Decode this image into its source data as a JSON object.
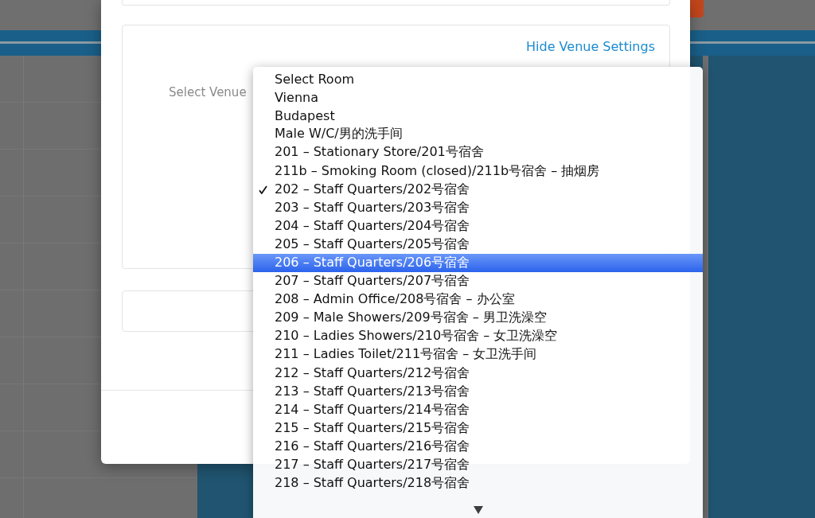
{
  "dialog": {
    "venue_settings": {
      "toggle_link": "Hide Venue Settings",
      "venue_label": "Select Venue"
    }
  },
  "room_dropdown": {
    "options": [
      {
        "label": "Select Room",
        "checked": false,
        "selected": false
      },
      {
        "label": "Vienna",
        "checked": false,
        "selected": false
      },
      {
        "label": "Budapest",
        "checked": false,
        "selected": false
      },
      {
        "label": "Male W/C/男的洗手间",
        "checked": false,
        "selected": false
      },
      {
        "label": "201 – Stationary Store/201号宿舍",
        "checked": false,
        "selected": false
      },
      {
        "label": "211b – Smoking Room (closed)/211b号宿舍 – 抽烟房",
        "checked": false,
        "selected": false
      },
      {
        "label": "202 – Staff Quarters/202号宿舍",
        "checked": true,
        "selected": false
      },
      {
        "label": "203 – Staff Quarters/203号宿舍",
        "checked": false,
        "selected": false
      },
      {
        "label": "204 – Staff Quarters/204号宿舍",
        "checked": false,
        "selected": false
      },
      {
        "label": "205 – Staff Quarters/205号宿舍",
        "checked": false,
        "selected": false
      },
      {
        "label": "206 – Staff Quarters/206号宿舍",
        "checked": false,
        "selected": true
      },
      {
        "label": "207 – Staff Quarters/207号宿舍",
        "checked": false,
        "selected": false
      },
      {
        "label": "208 – Admin Office/208号宿舍 – 办公室",
        "checked": false,
        "selected": false
      },
      {
        "label": "209 – Male Showers/209号宿舍 – 男卫洗澡空",
        "checked": false,
        "selected": false
      },
      {
        "label": "210 – Ladies Showers/210号宿舍 – 女卫洗澡空",
        "checked": false,
        "selected": false
      },
      {
        "label": "211 – Ladies Toilet/211号宿舍 – 女卫洗手间",
        "checked": false,
        "selected": false
      },
      {
        "label": "212 – Staff Quarters/212号宿舍",
        "checked": false,
        "selected": false
      },
      {
        "label": "213 – Staff Quarters/213号宿舍",
        "checked": false,
        "selected": false
      },
      {
        "label": "214 – Staff Quarters/214号宿舍",
        "checked": false,
        "selected": false
      },
      {
        "label": "215 – Staff Quarters/215号宿舍",
        "checked": false,
        "selected": false
      },
      {
        "label": "216 – Staff Quarters/216号宿舍",
        "checked": false,
        "selected": false
      },
      {
        "label": "217 – Staff Quarters/217号宿舍",
        "checked": false,
        "selected": false
      },
      {
        "label": "218 – Staff Quarters/218号宿舍",
        "checked": false,
        "selected": false
      }
    ]
  }
}
